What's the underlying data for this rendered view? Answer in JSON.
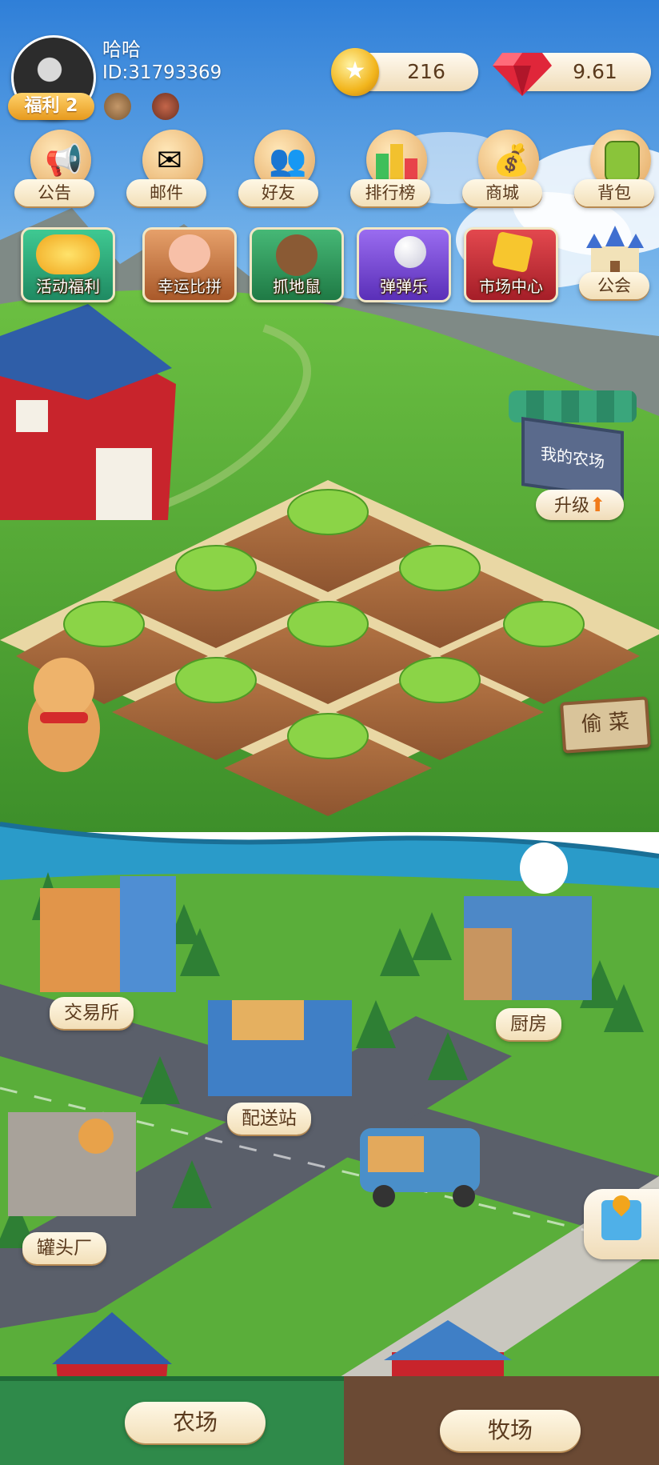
{
  "profile": {
    "name": "哈哈",
    "id": "ID:31793369",
    "welfare_badge": "福利 2"
  },
  "currency": {
    "coins": "216",
    "gems": "9.61"
  },
  "top_icons": [
    {
      "label": "公告",
      "icon": "megaphone-icon"
    },
    {
      "label": "邮件",
      "icon": "mail-icon"
    },
    {
      "label": "好友",
      "icon": "friends-icon"
    },
    {
      "label": "排行榜",
      "icon": "leaderboard-icon"
    },
    {
      "label": "商城",
      "icon": "shop-icon"
    },
    {
      "label": "背包",
      "icon": "backpack-icon"
    }
  ],
  "activity_tiles": [
    {
      "label": "活动福利",
      "color": "#2aa87a"
    },
    {
      "label": "幸运比拼",
      "color": "#c97a3e"
    },
    {
      "label": "抓地鼠",
      "color": "#2f9a5c"
    },
    {
      "label": "弹弹乐",
      "color": "#7b4bd6"
    },
    {
      "label": "市场中心",
      "color": "#c8323a"
    }
  ],
  "guild": {
    "label": "公会"
  },
  "farm_sign": {
    "title": "我的农场",
    "upgrade": "升级"
  },
  "steal_sign": "偷 菜",
  "buildings": {
    "exchange": "交易所",
    "kitchen": "厨房",
    "delivery": "配送站",
    "cannery": "罐头厂"
  },
  "bottom_nav": {
    "farm": "农场",
    "ranch": "牧场"
  },
  "colors": {
    "grass": "#4fa632",
    "soil": "#a9683c",
    "road": "#5a5f6a",
    "river": "#2a9bc9",
    "sky": "#3b8fe0"
  }
}
